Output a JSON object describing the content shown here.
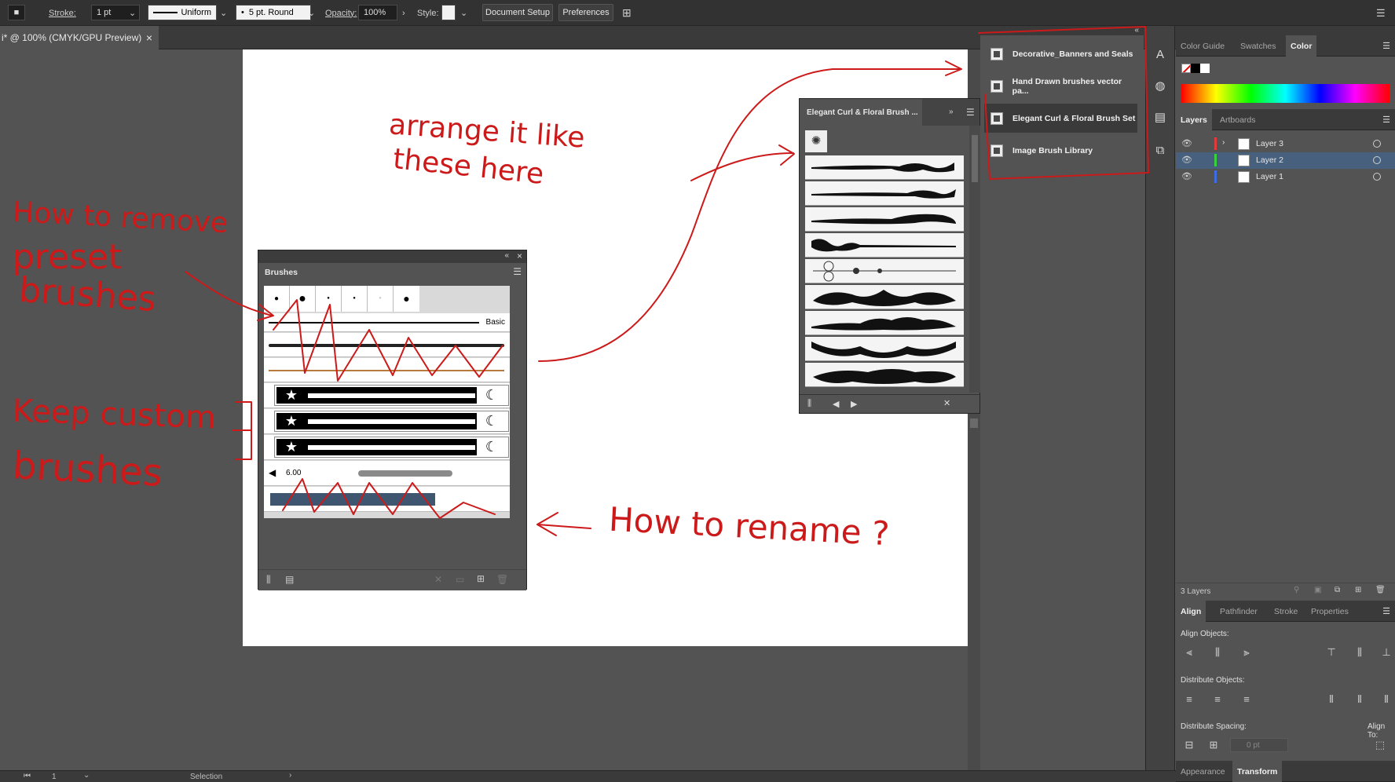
{
  "toolbar": {
    "stroke_label": "Stroke:",
    "stroke_value": "1 pt",
    "stroke_profile": "Uniform",
    "brush_def": "5 pt. Round",
    "opacity_label": "Opacity:",
    "opacity_value": "100%",
    "style_label": "Style:",
    "document_setup": "Document Setup",
    "preferences": "Preferences"
  },
  "document_tab": {
    "title": "i* @ 100% (CMYK/GPU Preview)",
    "close": "×"
  },
  "brushes_panel": {
    "title": "Brushes",
    "basic_label": "Basic",
    "scatter_value": "6.00"
  },
  "floral_panel": {
    "title": "Elegant Curl & Floral Brush ..."
  },
  "brush_libraries": {
    "items": [
      "Decorative_Banners and Seals",
      "Hand Drawn brushes vector pa...",
      "Elegant Curl & Floral Brush Set",
      "Image Brush Library"
    ]
  },
  "color_panel": {
    "tabs": [
      "Color Guide",
      "Swatches",
      "Color"
    ]
  },
  "layers_panel": {
    "tabs": [
      "Layers",
      "Artboards"
    ],
    "layers": [
      {
        "name": "Layer 3",
        "color": "#e23b3b"
      },
      {
        "name": "Layer 2",
        "color": "#3bd13b"
      },
      {
        "name": "Layer 1",
        "color": "#3b6ee2"
      }
    ],
    "count": "3 Layers"
  },
  "align_panel": {
    "tabs": [
      "Align",
      "Pathfinder",
      "Stroke",
      "Properties"
    ],
    "align_objects": "Align Objects:",
    "distribute_objects": "Distribute Objects:",
    "distribute_spacing": "Distribute Spacing:",
    "align_to": "Align To:",
    "spacing_value": "0 pt"
  },
  "bottom_tabs": [
    "Appearance",
    "Transform"
  ],
  "status": {
    "zoom": "1",
    "tool": "Selection"
  },
  "annotations": {
    "arrange_1": "arrange   it  like",
    "arrange_2": "these   here",
    "remove_1": "How   to  remove",
    "remove_2": "preset",
    "remove_3": "brushes",
    "keep_1": "Keep  custom",
    "keep_2": "brushes",
    "rename": "How   to  rename ?"
  },
  "colors": {
    "annotation_red": "#cc1a1a",
    "ui_dark": "#323232",
    "ui_panel": "#535353",
    "selected_layer": "#46607e"
  }
}
